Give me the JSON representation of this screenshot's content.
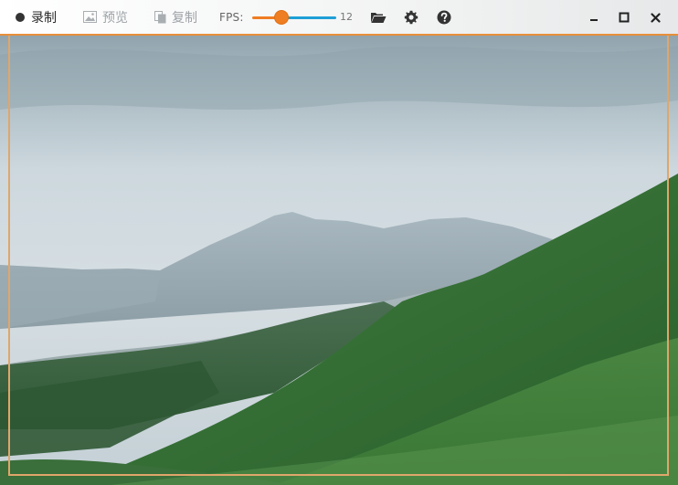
{
  "toolbar": {
    "record_label": "录制",
    "preview_label": "预览",
    "copy_label": "复制",
    "fps_label": "FPS:",
    "fps_value": "12",
    "fps_fraction": 0.35
  },
  "window_controls": {
    "minimize_icon": "minimize-icon",
    "maximize_icon": "maximize-icon",
    "close_icon": "close-icon"
  },
  "icons": {
    "record": "record-dot-icon",
    "preview": "image-icon",
    "copy": "copy-icon",
    "open_folder": "folder-open-icon",
    "settings": "gear-icon",
    "help": "help-icon"
  },
  "colors": {
    "accent": "#ef7d22",
    "slider_rest": "#1e9fd6",
    "frame_border": "#e0a66a"
  }
}
